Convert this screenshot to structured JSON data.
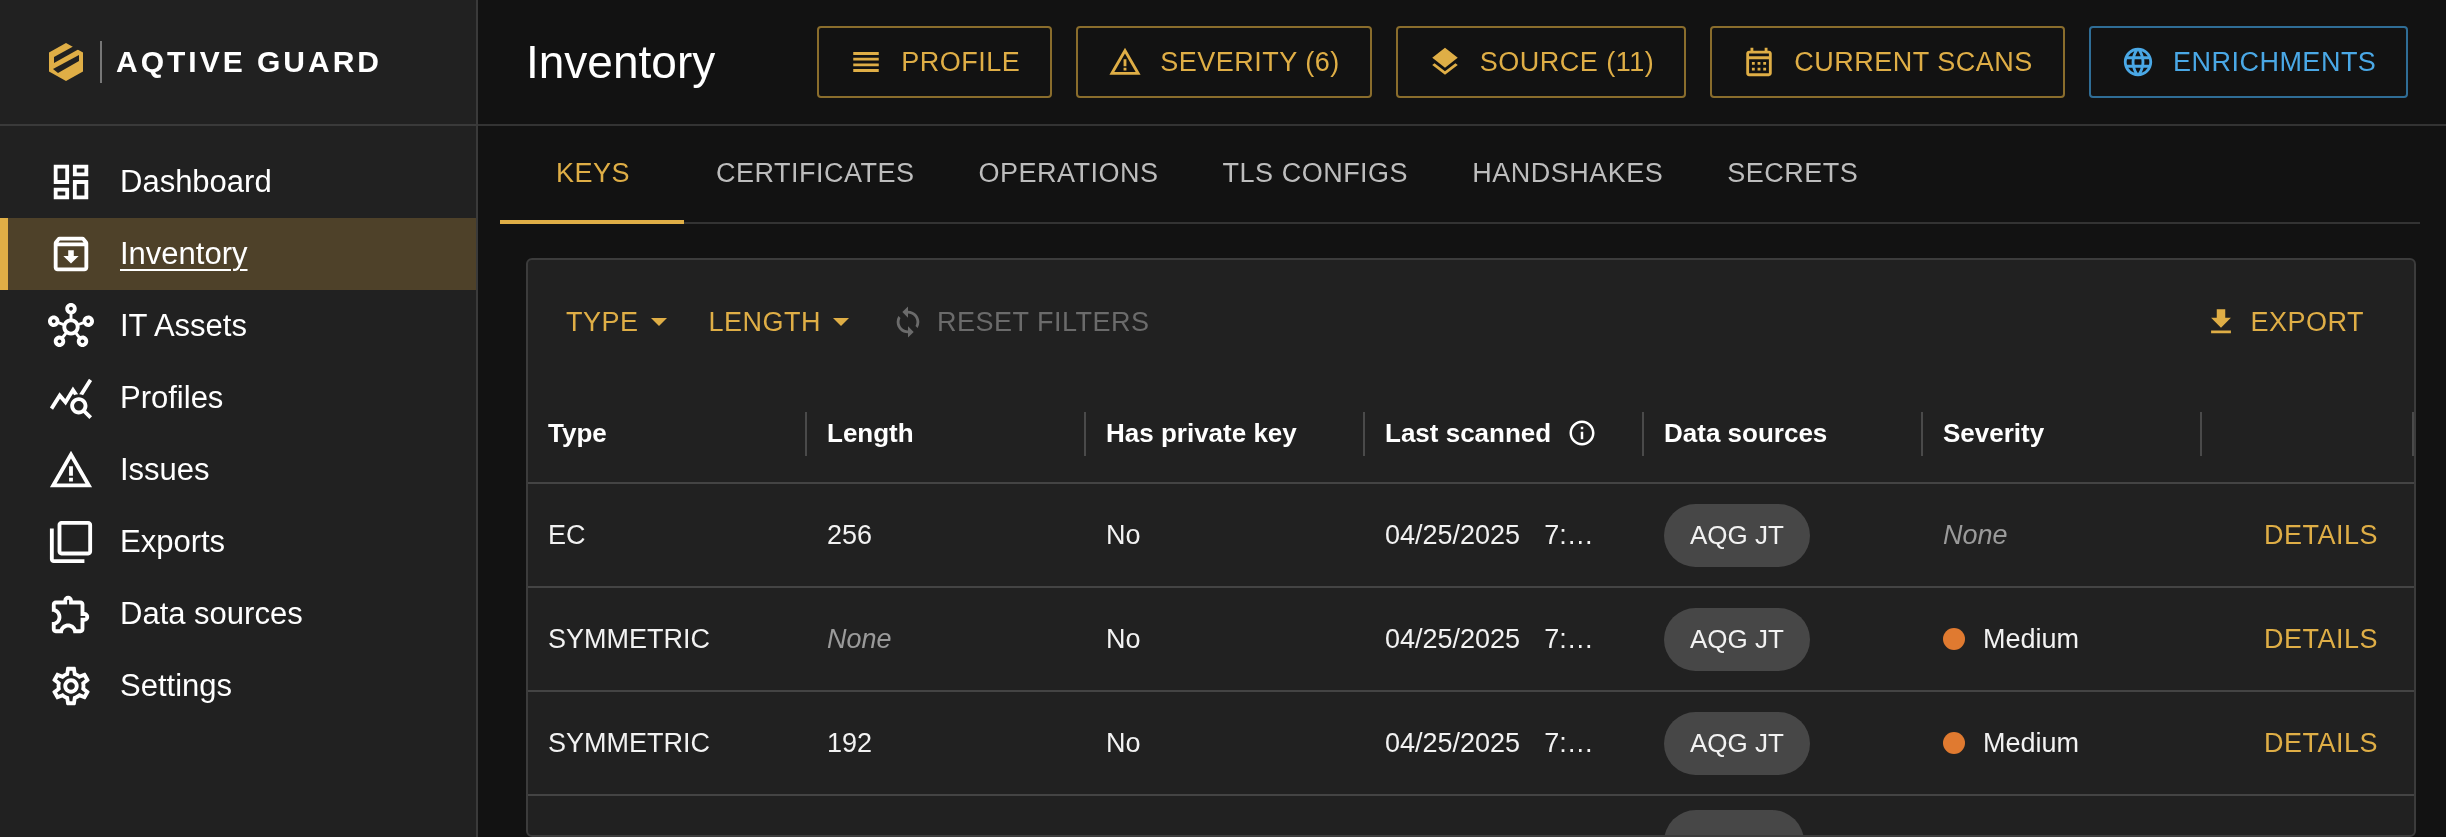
{
  "brand": {
    "name": "AQTIVE GUARD"
  },
  "sidebar": {
    "items": [
      {
        "label": "Dashboard",
        "selected": false
      },
      {
        "label": "Inventory",
        "selected": true
      },
      {
        "label": "IT Assets",
        "selected": false
      },
      {
        "label": "Profiles",
        "selected": false
      },
      {
        "label": "Issues",
        "selected": false
      },
      {
        "label": "Exports",
        "selected": false
      },
      {
        "label": "Data sources",
        "selected": false
      },
      {
        "label": "Settings",
        "selected": false
      }
    ]
  },
  "page": {
    "title": "Inventory"
  },
  "toolbar_buttons": [
    {
      "label": "PROFILE",
      "kind": "gold"
    },
    {
      "label": "SEVERITY (6)",
      "kind": "gold"
    },
    {
      "label": "SOURCE (11)",
      "kind": "gold"
    },
    {
      "label": "CURRENT SCANS",
      "kind": "gold"
    },
    {
      "label": "ENRICHMENTS",
      "kind": "blue"
    }
  ],
  "tabs": [
    {
      "label": "KEYS",
      "selected": true
    },
    {
      "label": "CERTIFICATES",
      "selected": false
    },
    {
      "label": "OPERATIONS",
      "selected": false
    },
    {
      "label": "TLS CONFIGS",
      "selected": false
    },
    {
      "label": "HANDSHAKES",
      "selected": false
    },
    {
      "label": "SECRETS",
      "selected": false
    }
  ],
  "filters": [
    {
      "label": "TYPE",
      "kind": "dropdown",
      "disabled": false
    },
    {
      "label": "LENGTH",
      "kind": "dropdown",
      "disabled": false
    },
    {
      "label": "RESET FILTERS",
      "kind": "reset",
      "disabled": true
    }
  ],
  "export": {
    "label": "EXPORT"
  },
  "table": {
    "columns": [
      {
        "label": "Type",
        "kind": "plain"
      },
      {
        "label": "Length",
        "kind": "plain"
      },
      {
        "label": "Has private key",
        "kind": "plain"
      },
      {
        "label": "Last scanned",
        "kind": "info"
      },
      {
        "label": "Data sources",
        "kind": "plain"
      },
      {
        "label": "Severity",
        "kind": "plain"
      }
    ],
    "rows": [
      {
        "type": "EC",
        "length": {
          "text": "256",
          "muted": false
        },
        "has_private_key": "No",
        "last_scanned": {
          "date": "04/25/2025",
          "time": "7:…"
        },
        "data_sources": [
          "AQG JT"
        ],
        "severity": {
          "text": "None",
          "muted": true
        },
        "action": "DETAILS"
      },
      {
        "type": "SYMMETRIC",
        "length": {
          "text": "None",
          "muted": true
        },
        "has_private_key": "No",
        "last_scanned": {
          "date": "04/25/2025",
          "time": "7:…"
        },
        "data_sources": [
          "AQG JT"
        ],
        "severity": {
          "text": "Medium",
          "muted": false,
          "color": "#e07a30"
        },
        "action": "DETAILS"
      },
      {
        "type": "SYMMETRIC",
        "length": {
          "text": "192",
          "muted": false
        },
        "has_private_key": "No",
        "last_scanned": {
          "date": "04/25/2025",
          "time": "7:…"
        },
        "data_sources": [
          "AQG JT"
        ],
        "severity": {
          "text": "Medium",
          "muted": false,
          "color": "#e07a30"
        },
        "action": "DETAILS"
      }
    ]
  }
}
